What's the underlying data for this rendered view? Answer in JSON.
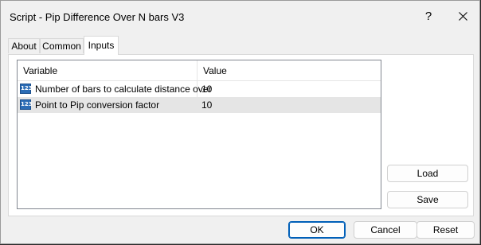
{
  "window": {
    "title": "Script - Pip Difference Over N bars V3",
    "help_label": "?",
    "close_icon": "close-icon"
  },
  "tabs": [
    {
      "label": "About",
      "active": false
    },
    {
      "label": "Common",
      "active": false
    },
    {
      "label": "Inputs",
      "active": true
    }
  ],
  "inputs_table": {
    "headers": {
      "variable": "Variable",
      "value": "Value"
    },
    "rows": [
      {
        "icon": "123",
        "variable": "Number of bars to calculate distance over",
        "value": "10",
        "selected": false
      },
      {
        "icon": "123",
        "variable": "Point to Pip conversion factor",
        "value": "10",
        "selected": true
      }
    ]
  },
  "side_buttons": {
    "load": "Load",
    "save": "Save"
  },
  "footer_buttons": {
    "ok": "OK",
    "cancel": "Cancel",
    "reset": "Reset"
  },
  "colors": {
    "accent": "#005fb8",
    "selected_row": "#e5e5e5",
    "int_icon": "#2b6cb5"
  }
}
